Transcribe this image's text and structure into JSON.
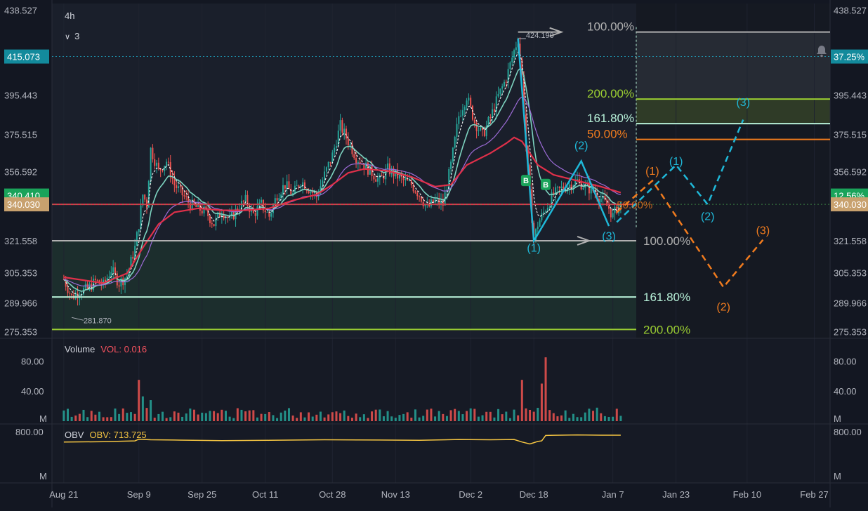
{
  "header": {
    "interval": "4h",
    "indicator_count": "3"
  },
  "colors": {
    "bg": "#161a25",
    "grid": "#1f2330",
    "up": "#26a69a",
    "down": "#ef5350",
    "ema_fast": "#ffffff",
    "ema_mid": "#7dd3c0",
    "ema_slow": "#9c6bd6",
    "ema_long": "#e0304a",
    "cyan": "#1fb8d8",
    "orange": "#f07b1e",
    "gray": "#b0b0b0",
    "lime": "#9acd32",
    "mint": "#b7f0d8",
    "obv": "#f5c542"
  },
  "chart_data": [
    {
      "type": "line",
      "panel": "price",
      "interval": "4h",
      "y_ticks": [
        "438.527",
        "395.443",
        "375.515",
        "356.592",
        "321.558",
        "305.353",
        "289.966",
        "275.353"
      ],
      "ylim": [
        272.0,
        442.0
      ],
      "x_ticks": [
        "Aug 21",
        "Sep 9",
        "Sep 25",
        "Oct 11",
        "Oct 28",
        "Nov 13",
        "Dec 2",
        "Dec 18",
        "Jan 7",
        "Jan 23",
        "Feb 10",
        "Feb 27"
      ],
      "x_tick_days": [
        0,
        19,
        35,
        51,
        68,
        84,
        103,
        119,
        139,
        155,
        173,
        190
      ],
      "xlim": [
        -3,
        194
      ],
      "last_price_day": 141,
      "close_series": [
        {
          "d": 0,
          "v": 302
        },
        {
          "d": 2,
          "v": 293
        },
        {
          "d": 4,
          "v": 296
        },
        {
          "d": 6,
          "v": 297
        },
        {
          "d": 8,
          "v": 301
        },
        {
          "d": 10,
          "v": 299
        },
        {
          "d": 12,
          "v": 307
        },
        {
          "d": 14,
          "v": 300
        },
        {
          "d": 16,
          "v": 304
        },
        {
          "d": 18,
          "v": 318
        },
        {
          "d": 19,
          "v": 330
        },
        {
          "d": 20,
          "v": 345
        },
        {
          "d": 21,
          "v": 340
        },
        {
          "d": 22,
          "v": 368
        },
        {
          "d": 24,
          "v": 357
        },
        {
          "d": 26,
          "v": 362
        },
        {
          "d": 28,
          "v": 350
        },
        {
          "d": 30,
          "v": 345
        },
        {
          "d": 32,
          "v": 340
        },
        {
          "d": 34,
          "v": 338
        },
        {
          "d": 36,
          "v": 336
        },
        {
          "d": 38,
          "v": 330
        },
        {
          "d": 40,
          "v": 337
        },
        {
          "d": 42,
          "v": 332
        },
        {
          "d": 44,
          "v": 338
        },
        {
          "d": 46,
          "v": 342
        },
        {
          "d": 48,
          "v": 335
        },
        {
          "d": 50,
          "v": 340
        },
        {
          "d": 52,
          "v": 334
        },
        {
          "d": 54,
          "v": 345
        },
        {
          "d": 56,
          "v": 350
        },
        {
          "d": 58,
          "v": 345
        },
        {
          "d": 60,
          "v": 352
        },
        {
          "d": 62,
          "v": 348
        },
        {
          "d": 64,
          "v": 344
        },
        {
          "d": 66,
          "v": 355
        },
        {
          "d": 68,
          "v": 365
        },
        {
          "d": 70,
          "v": 380
        },
        {
          "d": 72,
          "v": 372
        },
        {
          "d": 74,
          "v": 364
        },
        {
          "d": 76,
          "v": 360
        },
        {
          "d": 78,
          "v": 356
        },
        {
          "d": 80,
          "v": 352
        },
        {
          "d": 82,
          "v": 358
        },
        {
          "d": 84,
          "v": 355
        },
        {
          "d": 86,
          "v": 352
        },
        {
          "d": 88,
          "v": 350
        },
        {
          "d": 90,
          "v": 345
        },
        {
          "d": 92,
          "v": 338
        },
        {
          "d": 94,
          "v": 342
        },
        {
          "d": 96,
          "v": 340
        },
        {
          "d": 98,
          "v": 360
        },
        {
          "d": 100,
          "v": 385
        },
        {
          "d": 102,
          "v": 395
        },
        {
          "d": 104,
          "v": 382
        },
        {
          "d": 106,
          "v": 375
        },
        {
          "d": 108,
          "v": 384
        },
        {
          "d": 110,
          "v": 395
        },
        {
          "d": 112,
          "v": 404
        },
        {
          "d": 114,
          "v": 418
        },
        {
          "d": 115,
          "v": 424
        },
        {
          "d": 116,
          "v": 405
        },
        {
          "d": 117,
          "v": 370
        },
        {
          "d": 118,
          "v": 345
        },
        {
          "d": 119,
          "v": 322
        },
        {
          "d": 120,
          "v": 330
        },
        {
          "d": 122,
          "v": 338
        },
        {
          "d": 124,
          "v": 345
        },
        {
          "d": 126,
          "v": 348
        },
        {
          "d": 128,
          "v": 350
        },
        {
          "d": 130,
          "v": 352
        },
        {
          "d": 132,
          "v": 349
        },
        {
          "d": 134,
          "v": 347
        },
        {
          "d": 136,
          "v": 343
        },
        {
          "d": 138,
          "v": 338
        },
        {
          "d": 139,
          "v": 334
        },
        {
          "d": 140,
          "v": 338
        },
        {
          "d": 141,
          "v": 340
        }
      ],
      "ema_long_series": [
        {
          "d": 0,
          "v": 303
        },
        {
          "d": 10,
          "v": 300
        },
        {
          "d": 16,
          "v": 305
        },
        {
          "d": 20,
          "v": 318
        },
        {
          "d": 24,
          "v": 330
        },
        {
          "d": 28,
          "v": 336
        },
        {
          "d": 34,
          "v": 338
        },
        {
          "d": 40,
          "v": 337
        },
        {
          "d": 46,
          "v": 337
        },
        {
          "d": 52,
          "v": 338
        },
        {
          "d": 58,
          "v": 342
        },
        {
          "d": 64,
          "v": 345
        },
        {
          "d": 68,
          "v": 350
        },
        {
          "d": 72,
          "v": 356
        },
        {
          "d": 76,
          "v": 358
        },
        {
          "d": 82,
          "v": 357
        },
        {
          "d": 88,
          "v": 354
        },
        {
          "d": 94,
          "v": 349
        },
        {
          "d": 98,
          "v": 350
        },
        {
          "d": 102,
          "v": 360
        },
        {
          "d": 108,
          "v": 366
        },
        {
          "d": 112,
          "v": 371
        },
        {
          "d": 114,
          "v": 374
        },
        {
          "d": 116,
          "v": 372
        },
        {
          "d": 118,
          "v": 366
        },
        {
          "d": 120,
          "v": 360
        },
        {
          "d": 124,
          "v": 355
        },
        {
          "d": 130,
          "v": 352
        },
        {
          "d": 136,
          "v": 349
        },
        {
          "d": 141,
          "v": 346
        }
      ],
      "fib_lines": [
        {
          "label": "100.00%",
          "value": 321.558,
          "color": "#b0b0b0",
          "side": "left"
        },
        {
          "label": "161.80%",
          "value": 293.0,
          "color": "#b7f0d8",
          "side": "left"
        },
        {
          "label": "200.00%",
          "value": 276.5,
          "color": "#9acd32",
          "side": "left"
        },
        {
          "label": "100.00%",
          "value": 427.5,
          "color": "#b0b0b0",
          "side": "right"
        },
        {
          "label": "200.00%",
          "value": 393.5,
          "color": "#9acd32",
          "side": "right"
        },
        {
          "label": "161.80%",
          "value": 381.0,
          "color": "#b7f0d8",
          "side": "right"
        },
        {
          "label": "50.00%",
          "value": 373.0,
          "color": "#f07b1e",
          "side": "right"
        }
      ],
      "annotations": {
        "high_label": "424.190",
        "low_label": "281.870",
        "mid_fib_label": "50.00%",
        "cyan_waves": [
          {
            "label": "(1)",
            "day": 119,
            "value": 316
          },
          {
            "label": "(2)",
            "day": 131,
            "value": 368
          },
          {
            "label": "(3)",
            "day": 138,
            "value": 322
          },
          {
            "label": "(1)",
            "day": 155,
            "value": 360
          },
          {
            "label": "(2)",
            "day": 163,
            "value": 332
          },
          {
            "label": "(3)",
            "day": 172,
            "value": 390
          }
        ],
        "orange_waves": [
          {
            "label": "(1)",
            "day": 149,
            "value": 355
          },
          {
            "label": "(2)",
            "day": 167,
            "value": 286
          },
          {
            "label": "(3)",
            "day": 177,
            "value": 325
          }
        ],
        "buy_markers": [
          {
            "day": 117,
            "value": 350,
            "label": "B"
          },
          {
            "day": 122,
            "value": 348,
            "label": "B"
          }
        ]
      },
      "price_badges": [
        {
          "left": "415.073",
          "right": "37.25%",
          "value": 415.073,
          "color": "#138a9c"
        },
        {
          "left": "340.410",
          "right": "12.56%",
          "value": 344.5,
          "color": "#1aa35a"
        },
        {
          "left": "340.030",
          "right": "340.030",
          "value": 340.03,
          "color": "#c8a16e"
        }
      ]
    },
    {
      "type": "bar",
      "panel": "volume",
      "title": "Volume",
      "value_label": "VOL: 0.016",
      "y_ticks": [
        "80.00",
        "40.00",
        "M"
      ],
      "ylim": [
        0,
        100
      ],
      "spikes": [
        {
          "d": 19,
          "v": 55
        },
        {
          "d": 20,
          "v": 33
        },
        {
          "d": 22,
          "v": 28
        },
        {
          "d": 116,
          "v": 55
        },
        {
          "d": 122,
          "v": 85
        },
        {
          "d": 121,
          "v": 50
        }
      ]
    },
    {
      "type": "line",
      "panel": "obv",
      "title": "OBV",
      "value_label": "OBV: 713.725",
      "y_ticks": [
        "800.00",
        "M"
      ],
      "ylim": [
        0,
        900
      ],
      "series": [
        {
          "d": 0,
          "v": 620
        },
        {
          "d": 10,
          "v": 625
        },
        {
          "d": 18,
          "v": 640
        },
        {
          "d": 19,
          "v": 670
        },
        {
          "d": 22,
          "v": 660
        },
        {
          "d": 28,
          "v": 655
        },
        {
          "d": 40,
          "v": 645
        },
        {
          "d": 52,
          "v": 650
        },
        {
          "d": 66,
          "v": 660
        },
        {
          "d": 80,
          "v": 655
        },
        {
          "d": 90,
          "v": 650
        },
        {
          "d": 100,
          "v": 665
        },
        {
          "d": 108,
          "v": 660
        },
        {
          "d": 114,
          "v": 665
        },
        {
          "d": 116,
          "v": 620
        },
        {
          "d": 118,
          "v": 585
        },
        {
          "d": 120,
          "v": 630
        },
        {
          "d": 121,
          "v": 640
        },
        {
          "d": 122,
          "v": 735
        },
        {
          "d": 124,
          "v": 738
        },
        {
          "d": 130,
          "v": 745
        },
        {
          "d": 136,
          "v": 740
        },
        {
          "d": 141,
          "v": 740
        }
      ]
    }
  ]
}
